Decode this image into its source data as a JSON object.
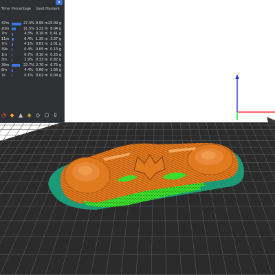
{
  "legend": {
    "header": {
      "time": "Time",
      "percentage": "Percentage",
      "filament": "Used filament"
    },
    "rows": [
      {
        "time": "47m",
        "percent_label": "27.3%",
        "percent": 27.3,
        "meters": "9.99 m",
        "grams": "25.09 g"
      },
      {
        "time": "20m",
        "percent_label": "11.5%",
        "percent": 11.5,
        "meters": "3.22 m",
        "grams": "8.04 g"
      },
      {
        "time": "7m",
        "percent_label": "4.3%",
        "percent": 4.3,
        "meters": "0.16 m",
        "grams": "0.41 g"
      },
      {
        "time": "11m",
        "percent_label": "6.4%",
        "percent": 6.4,
        "meters": "1.35 m",
        "grams": "3.37 g"
      },
      {
        "time": "7m",
        "percent_label": "4.1%",
        "percent": 4.1,
        "meters": "0.81 m",
        "grams": "2.01 g"
      },
      {
        "time": "39s",
        "percent_label": "0.4%",
        "percent": 0.4,
        "meters": "0.05 m",
        "grams": "0.13 g"
      },
      {
        "time": "1m",
        "percent_label": "0.7%",
        "percent": 0.7,
        "meters": "0.10 m",
        "grams": "0.25 g"
      },
      {
        "time": "3m",
        "percent_label": "1.9%",
        "percent": 1.9,
        "meters": "0.33 m",
        "grams": "0.82 g"
      },
      {
        "time": "39m",
        "percent_label": "22.7%",
        "percent": 22.7,
        "meters": "2.70 m",
        "grams": "6.75 g"
      },
      {
        "time": "8m",
        "percent_label": "4.4%",
        "percent": 4.4,
        "meters": "0.66 m",
        "grams": "1.66 g"
      },
      {
        "time": "7s",
        "percent_label": "0.1%",
        "percent": 0.1,
        "meters": "0.02 m",
        "grams": "0.04 g"
      }
    ],
    "toolbar_icons": [
      "shell-icon",
      "overhang-icon",
      "seam-icon",
      "wipe-icon",
      "view-icon",
      "cube-icon",
      "export-icon"
    ],
    "bar_color": "#3b78e7"
  },
  "scene": {
    "bed_color": "#2b2b2b",
    "grid_color": "#5a5a5a",
    "model_color": "#e07a1f",
    "support_color": "#3ddc2c",
    "brim_color": "#1c9a78",
    "axes_colors": {
      "x": "#ff2e2e",
      "y": "#18e04a",
      "z": "#2a3fe0"
    }
  }
}
